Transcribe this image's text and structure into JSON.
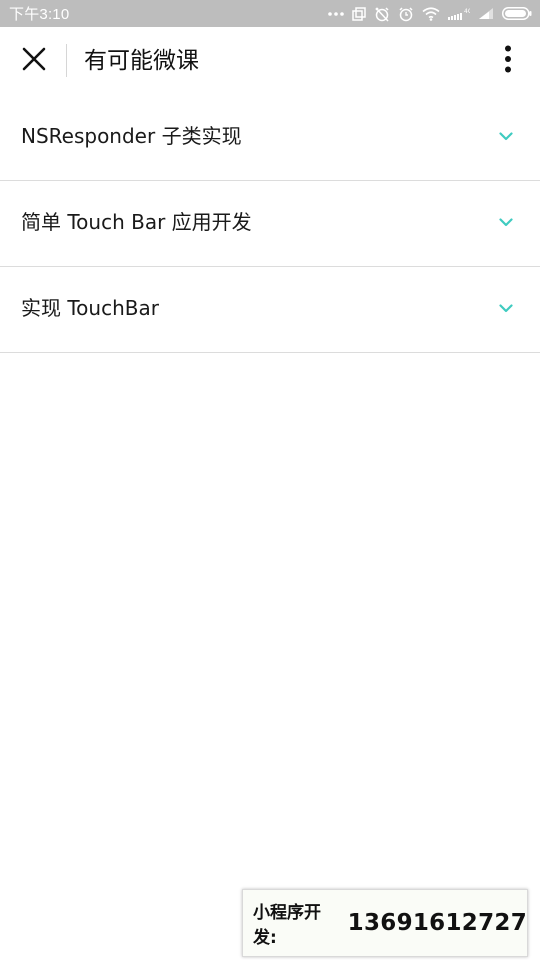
{
  "status_bar": {
    "time": "下午3:10",
    "icons": [
      "more-dots-icon",
      "screen-share-icon",
      "alarm-off-icon",
      "clock-icon",
      "wifi-icon",
      "hd-signal-icon",
      "cell-signal-icon",
      "battery-icon"
    ],
    "network_badge": "4G"
  },
  "nav": {
    "title": "有可能微课",
    "close_icon": "close-icon",
    "more_icon": "more-vertical-icon"
  },
  "courses": [
    {
      "label": "NSResponder 子类实现"
    },
    {
      "label": "简单 Touch Bar 应用开发"
    },
    {
      "label": "实现 TouchBar"
    }
  ],
  "colors": {
    "status_bar_bg": "#bdbdbd",
    "chevron": "#3fcbc0",
    "divider": "#dcdcdc"
  },
  "contact_badge": {
    "label": "小程序开发:",
    "number": "13691612727"
  }
}
